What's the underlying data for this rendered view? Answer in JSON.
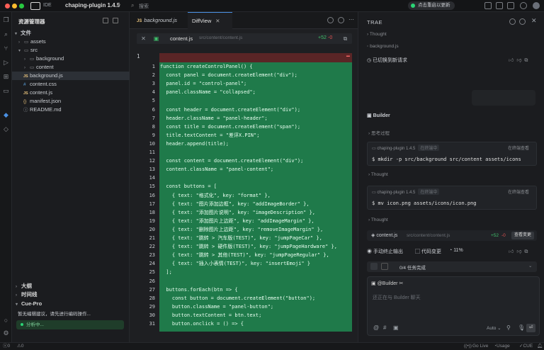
{
  "titlebar": {
    "app_badge": "IDE",
    "project": "chaping-plugin 1.4.5",
    "search_placeholder": "搜索",
    "update_label": "点击重启以更新"
  },
  "sidebar": {
    "title": "资源管理器",
    "tree": [
      {
        "label": "文件",
        "type": "section"
      },
      {
        "label": "assets",
        "type": "folder"
      },
      {
        "label": "src",
        "type": "folder-open"
      },
      {
        "label": "background",
        "type": "folder"
      },
      {
        "label": "content",
        "type": "folder"
      },
      {
        "label": "background.js",
        "type": "js",
        "active": true
      },
      {
        "label": "content.css",
        "type": "css"
      },
      {
        "label": "content.js",
        "type": "js"
      },
      {
        "label": "manifest.json",
        "type": "json"
      },
      {
        "label": "README.md",
        "type": "info"
      }
    ],
    "outline_label": "大纲",
    "timeline_label": "时间线",
    "cue_label": "Cue-Pro",
    "cue_desc": "暂无编辑建议，请先进行编码操作...",
    "cue_analysis": "分析中..."
  },
  "editor": {
    "tabs": [
      {
        "label": "background.js",
        "badge": "JS"
      },
      {
        "label": "DiffView",
        "badge": ""
      }
    ],
    "diff_file": "content.js",
    "diff_path": "src/content/content.js",
    "diff_added": "+52",
    "diff_removed": "-0",
    "removed_line_number": "1",
    "code_lines": [
      {
        "n": "1",
        "t": "function createControlPanel() {"
      },
      {
        "n": "2",
        "t": "  const panel = document.createElement(\"div\");"
      },
      {
        "n": "3",
        "t": "  panel.id = \"control-panel\";"
      },
      {
        "n": "4",
        "t": "  panel.className = \"collapsed\";"
      },
      {
        "n": "5",
        "t": ""
      },
      {
        "n": "6",
        "t": "  const header = document.createElement(\"div\");"
      },
      {
        "n": "7",
        "t": "  header.className = \"panel-header\";"
      },
      {
        "n": "8",
        "t": "  const title = document.createElement(\"span\");"
      },
      {
        "n": "9",
        "t": "  title.textContent = \"差评X.PIN\";"
      },
      {
        "n": "10",
        "t": "  header.append(title);"
      },
      {
        "n": "11",
        "t": ""
      },
      {
        "n": "12",
        "t": "  const content = document.createElement(\"div\");"
      },
      {
        "n": "13",
        "t": "  content.className = \"panel-content\";"
      },
      {
        "n": "14",
        "t": ""
      },
      {
        "n": "15",
        "t": "  const buttons = ["
      },
      {
        "n": "16",
        "t": "    { text: \"格式化\", key: \"format\" },"
      },
      {
        "n": "17",
        "t": "    { text: \"图片添加边框\", key: \"addImageBorder\" },"
      },
      {
        "n": "18",
        "t": "    { text: \"添加图片说明\", key: \"imageDescription\" },"
      },
      {
        "n": "19",
        "t": "    { text: \"添加图片上边距\", key: \"addImageMargin\" },"
      },
      {
        "n": "20",
        "t": "    { text: \"删除图片上边距\", key: \"removeImageMargin\" },"
      },
      {
        "n": "21",
        "t": "    { text: \"跳转 > 汽车版(TEST)\", key: \"jumpPageCar\" },"
      },
      {
        "n": "22",
        "t": "    { text: \"跳转 > 硬件版(TEST)\", key: \"jumpPageHardware\" },"
      },
      {
        "n": "23",
        "t": "    { text: \"跳转 > 其他(TEST)\", key: \"jumpPageRegular\" },"
      },
      {
        "n": "24",
        "t": "    { text: \"插入小表情(TEST)\", key: \"insertEmoji\" }"
      },
      {
        "n": "25",
        "t": "  ];"
      },
      {
        "n": "26",
        "t": ""
      },
      {
        "n": "27",
        "t": "  buttons.forEach(btn => {"
      },
      {
        "n": "28",
        "t": "    const button = document.createElement(\"button\");"
      },
      {
        "n": "29",
        "t": "    button.className = \"panel-button\";"
      },
      {
        "n": "30",
        "t": "    button.textContent = btn.text;"
      },
      {
        "n": "31",
        "t": "    button.onclick = () => {"
      }
    ]
  },
  "right_panel": {
    "title": "TRAE",
    "thought_1": "Thought",
    "path_1": "background.js",
    "switch_text": "已切换到新请求",
    "builder_label": "Builder",
    "thinking_label": "思考过程",
    "cmd1_head": "chaping-plugin 1.4.5",
    "cmd1_pill": "在终端中",
    "cmd1_right": "在终端查看",
    "cmd1_body": "mkdir -p src/background src/content assets/icons",
    "thought_2": "Thought",
    "cmd2_head": "chaping-plugin 1.4.5",
    "cmd2_pill": "在终端中",
    "cmd2_right": "在终端查看",
    "cmd2_body": "mv icon.png assets/icons/icon.png",
    "thought_3": "Thought",
    "change_file": "content.js",
    "change_path": "src/content/content.js",
    "change_added": "+52",
    "change_removed": "-0",
    "change_btn": "查看变更",
    "stop_label": "手动终止输出",
    "code_change_label": "代码变更",
    "percent": "11%",
    "task_label": "0/4 任务完成",
    "input_tag": "@Builder",
    "input_placeholder": "还正在与 Builder 聊天",
    "model_label": "Auto"
  },
  "statusbar": {
    "errors": "0",
    "warnings": "0",
    "golive": "Go Live",
    "usage": "Usage",
    "cue": "CUE"
  }
}
